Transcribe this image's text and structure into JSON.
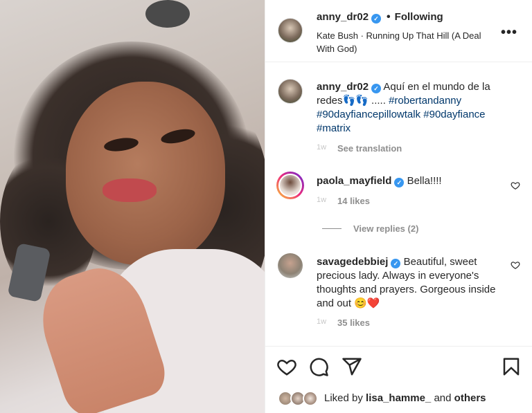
{
  "header": {
    "username": "anny_dr02",
    "verified_mark": "✓",
    "separator": "•",
    "follow_status": "Following",
    "audio": "Kate Bush · Running Up That Hill (A Deal With God)",
    "more_icon": "•••"
  },
  "caption": {
    "username": "anny_dr02",
    "text": "Aquí en el mundo de la redes👣👣 ..... ",
    "hashtags": [
      "#robertandanny",
      "#90dayfiancepillowtalk",
      "#90dayfiance",
      "#matrix"
    ],
    "time": "1w",
    "see_translation": "See translation"
  },
  "comments": [
    {
      "username": "paola_mayfield",
      "text": "Bella!!!!",
      "time": "1w",
      "likes": "14 likes",
      "view_replies": "View replies (2)"
    },
    {
      "username": "savagedebbiej",
      "text": "Beautiful, sweet precious lady. Always in everyone's thoughts and prayers. Gorgeous inside and out 😊❤️",
      "time": "1w",
      "likes": "35 likes"
    }
  ],
  "actions": {
    "like_icon": "heart-icon",
    "comment_icon": "comment-icon",
    "share_icon": "share-icon",
    "save_icon": "bookmark-icon",
    "liked_prefix": "Liked by ",
    "liked_user": "lisa_hamme_",
    "liked_and": " and ",
    "liked_others": "others"
  },
  "colors": {
    "verified": "#3897f0",
    "hashtag": "#00376b",
    "muted": "#8e8e8e"
  }
}
